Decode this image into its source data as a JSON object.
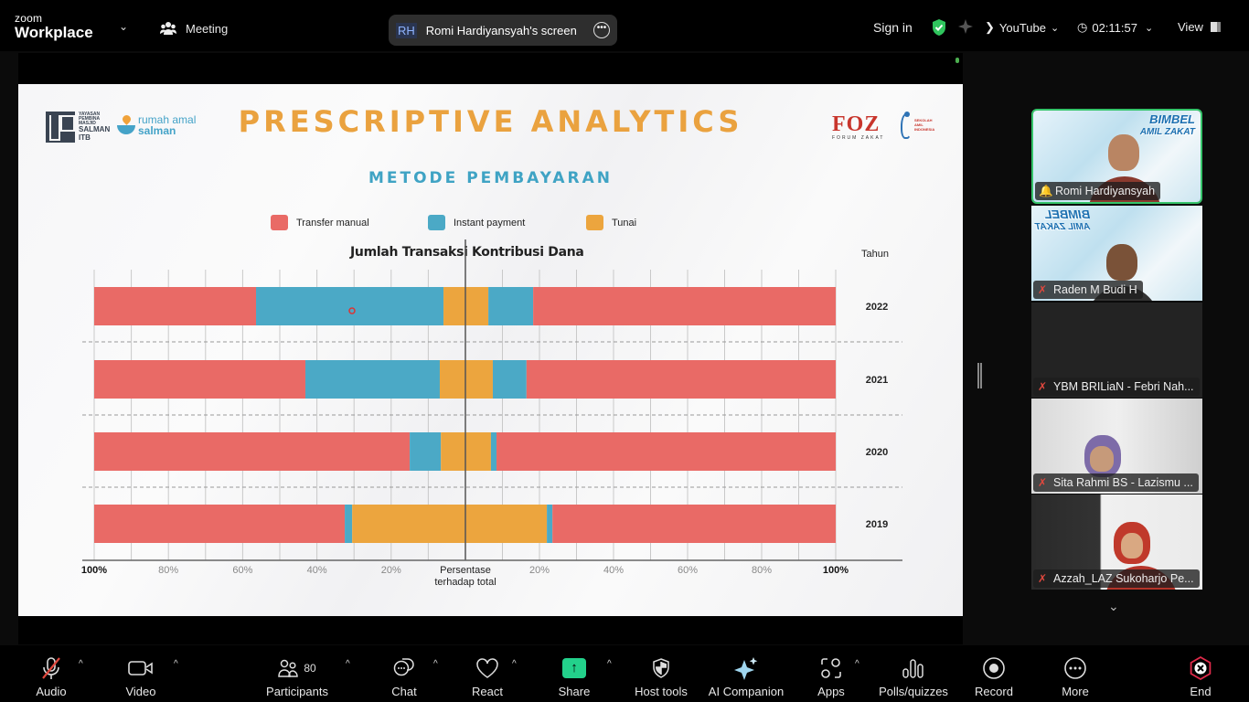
{
  "app": {
    "brand_small": "zoom",
    "brand_big": "Workplace",
    "meeting_label": "Meeting",
    "share_initials": "RH",
    "share_label": "Romi Hardiyansyah's screen",
    "sign_in": "Sign in",
    "stream_label": "YouTube",
    "timer": "02:11:57",
    "view_label": "View"
  },
  "slide": {
    "logo_ypm_lines": [
      "YAYASAN",
      "PEMBINA",
      "MASJID"
    ],
    "logo_ypm_bold": [
      "SALMAN",
      "ITB"
    ],
    "logo_ram_top": "rumah amal",
    "logo_ram_bottom": "salman",
    "logo_foz": "FOZ",
    "logo_foz_sub": "FORUM ZAKAT",
    "logo_ami_text": "SEKOLAH AMIL INDONESIA",
    "title": "PRESCRIPTIVE ANALYTICS",
    "subtitle": "METODE PEMBAYARAN"
  },
  "chart_data": {
    "type": "bar",
    "orientation": "horizontal-diverging-stacked",
    "title": "METODE PEMBAYARAN",
    "left_label": "Jumlah Transaksi",
    "right_label": "Kontribusi Dana",
    "category_label": "Tahun",
    "xlabel": "Persentase terhadap total",
    "categories": [
      "2022",
      "2021",
      "2020",
      "2019"
    ],
    "series": [
      {
        "name": "Transfer manual",
        "color": "#e96a66",
        "left_values": [
          43.6,
          56.9,
          85.0,
          67.5
        ],
        "right_values": [
          81.7,
          83.5,
          91.6,
          76.5
        ]
      },
      {
        "name": "Instant payment",
        "color": "#4ba9c6",
        "left_values": [
          50.5,
          36.2,
          8.4,
          2.0
        ],
        "right_values": [
          12.1,
          9.1,
          1.5,
          1.5
        ]
      },
      {
        "name": "Tunai",
        "color": "#eca53e",
        "left_values": [
          5.9,
          6.9,
          6.6,
          30.5
        ],
        "right_values": [
          6.2,
          7.4,
          6.9,
          22.0
        ]
      }
    ],
    "xlim_left": [
      100,
      0
    ],
    "xlim_right": [
      0,
      100
    ],
    "tick_labels_left": [
      "100%",
      "80%",
      "60%",
      "40%",
      "20%"
    ],
    "tick_labels_right": [
      "20%",
      "40%",
      "60%",
      "80%",
      "100%"
    ],
    "center_label_line1": "Persentase",
    "center_label_line2": "terhadap total",
    "grid": true,
    "legend_position": "top"
  },
  "participants": [
    {
      "name": "Romi Hardiyansyah",
      "status": "speaking",
      "video": true
    },
    {
      "name": "Raden M Budi H",
      "status": "muted",
      "video": true
    },
    {
      "name": "YBM BRILiaN - Febri Nah...",
      "status": "muted",
      "video": false
    },
    {
      "name": "Sita Rahmi BS - Lazismu ...",
      "status": "muted",
      "video": true
    },
    {
      "name": "Azzah_LAZ Sukoharjo Pe...",
      "status": "muted",
      "video": true
    }
  ],
  "tile_banner": [
    "BIMBEL",
    "AMIL ZAKAT"
  ],
  "toolbar": {
    "audio": "Audio",
    "video": "Video",
    "participants": "Participants",
    "participants_count": "80",
    "chat": "Chat",
    "react": "React",
    "share": "Share",
    "host_tools": "Host tools",
    "ai_companion": "AI Companion",
    "apps": "Apps",
    "polls": "Polls/quizzes",
    "record": "Record",
    "more": "More",
    "end": "End"
  },
  "colors": {
    "accent_green": "#35c46a",
    "share_green": "#23d18b",
    "end_red": "#e02a4a",
    "title_orange": "#eaa23f",
    "subtitle_blue": "#3fa3c4"
  }
}
